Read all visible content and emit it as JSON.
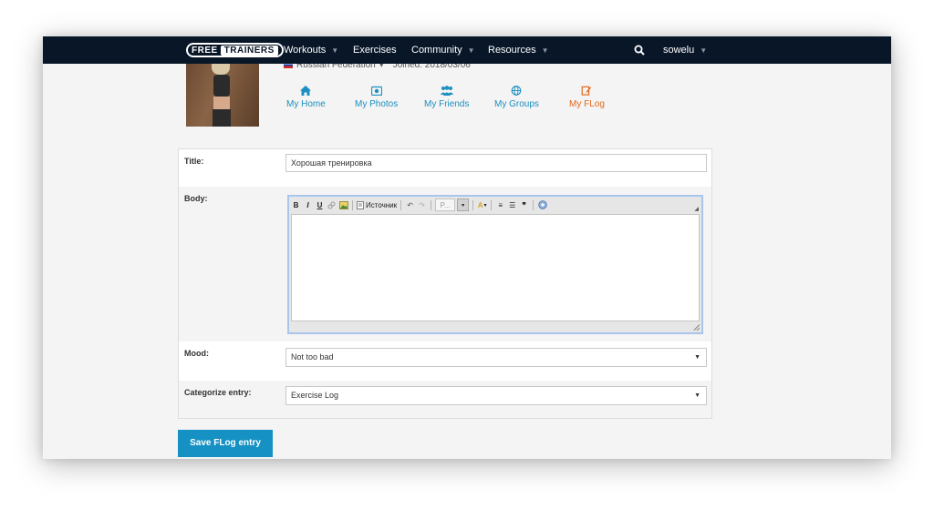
{
  "nav": {
    "logo_part1": "FREE",
    "logo_part2": "TRAINERS",
    "items": [
      {
        "label": "Workouts",
        "has_caret": true
      },
      {
        "label": "Exercises",
        "has_caret": false
      },
      {
        "label": "Community",
        "has_caret": true
      },
      {
        "label": "Resources",
        "has_caret": true
      }
    ],
    "username": "sowelu",
    "search_icon": "search-icon",
    "caret_glyph": "▼"
  },
  "profile": {
    "country": "Russian Federation",
    "country_caret": "▾",
    "joined": "Joined: 2018/03/06",
    "links": [
      {
        "label": "My Home",
        "icon": "home-icon"
      },
      {
        "label": "My Photos",
        "icon": "photo-icon"
      },
      {
        "label": "My Friends",
        "icon": "users-icon"
      },
      {
        "label": "My Groups",
        "icon": "globe-icon"
      },
      {
        "label": "My FLog",
        "icon": "edit-icon",
        "active": true
      }
    ]
  },
  "form": {
    "title_label": "Title:",
    "title_value": "Хорошая тренировка",
    "body_label": "Body:",
    "body_value": "",
    "editor_toolbar": {
      "bold": "B",
      "italic": "I",
      "underline": "U",
      "source_label": "Источник",
      "format_label": "P...",
      "undo": "↶",
      "redo": "↷",
      "font_color": "A",
      "ordered_list": "≡",
      "bullet_list": "☰",
      "blockquote": "❞",
      "dropdown_caret": "▾"
    },
    "mood_label": "Mood:",
    "mood_value": "Not too bad",
    "category_label": "Categorize entry:",
    "category_value": "Exercise Log",
    "select_caret": "▼"
  },
  "save_label": "Save FLog entry",
  "colors": {
    "navbar_bg": "#081628",
    "link_blue": "#1b8fbf",
    "active_orange": "#e2671b",
    "button_blue": "#1591c3"
  }
}
